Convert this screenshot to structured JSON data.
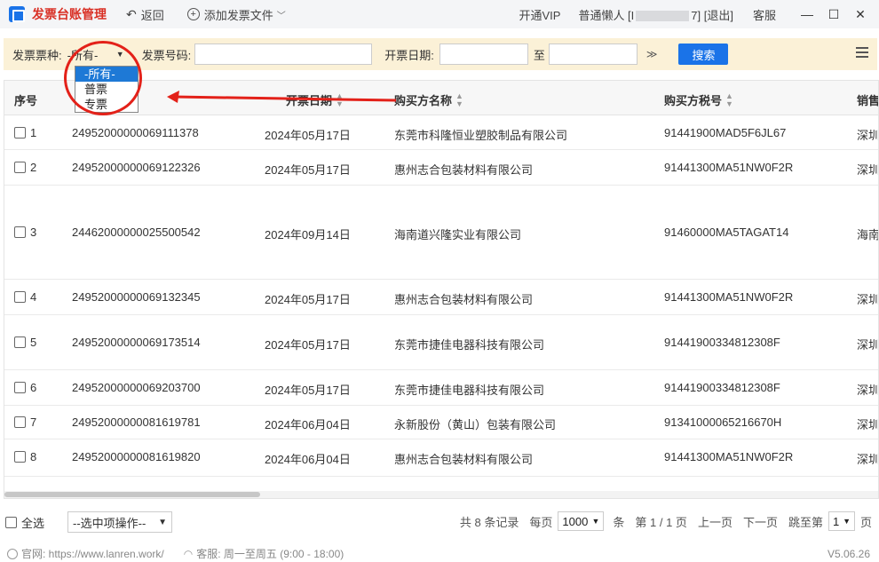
{
  "titlebar": {
    "app_title": "发票台账管理",
    "back_label": "返回",
    "add_label": "添加发票文件",
    "vip_label": "开通VIP",
    "user_prefix": "普通懒人 [I",
    "user_suffix": "7]",
    "logout_label": "[退出]",
    "service_label": "客服"
  },
  "filters": {
    "type_label": "发票票种:",
    "type_value": "-所有-",
    "type_options": [
      "-所有-",
      "普票",
      "专票"
    ],
    "number_label": "发票号码:",
    "number_value": "",
    "date_label": "开票日期:",
    "date_from": "",
    "date_to_label": "至",
    "date_to": "",
    "search_label": "搜索"
  },
  "table": {
    "columns": [
      "序号",
      "开票日期",
      "购买方名称",
      "购买方税号",
      "销售方"
    ],
    "rows": [
      {
        "idx": "1",
        "number": "24952000000069111378",
        "date": "2024年05月17日",
        "buyer": "东莞市科隆恒业塑胶制品有限公司",
        "tax": "91441900MAD5F6JL67",
        "seller": "深圳"
      },
      {
        "idx": "2",
        "number": "24952000000069122326",
        "date": "2024年05月17日",
        "buyer": "惠州志合包装材料有限公司",
        "tax": "91441300MA51NW0F2R",
        "seller": "深圳"
      },
      {
        "idx": "3",
        "number": "24462000000025500542",
        "date": "2024年09月14日",
        "buyer": "海南道兴隆实业有限公司",
        "tax": "91460000MA5TAGAT14",
        "seller": "海南"
      },
      {
        "idx": "4",
        "number": "24952000000069132345",
        "date": "2024年05月17日",
        "buyer": "惠州志合包装材料有限公司",
        "tax": "91441300MA51NW0F2R",
        "seller": "深圳"
      },
      {
        "idx": "5",
        "number": "24952000000069173514",
        "date": "2024年05月17日",
        "buyer": "东莞市捷佳电器科技有限公司",
        "tax": "91441900334812308F",
        "seller": "深圳"
      },
      {
        "idx": "6",
        "number": "24952000000069203700",
        "date": "2024年05月17日",
        "buyer": "东莞市捷佳电器科技有限公司",
        "tax": "91441900334812308F",
        "seller": "深圳"
      },
      {
        "idx": "7",
        "number": "24952000000081619781",
        "date": "2024年06月04日",
        "buyer": "永新股份（黄山）包装有限公司",
        "tax": "91341000065216670H",
        "seller": "深圳"
      },
      {
        "idx": "8",
        "number": "24952000000081619820",
        "date": "2024年06月04日",
        "buyer": "惠州志合包装材料有限公司",
        "tax": "91441300MA51NW0F2R",
        "seller": "深圳"
      }
    ]
  },
  "footer": {
    "select_all": "全选",
    "batch_action": "--选中项操作--",
    "total": "共 8 条记录",
    "per_page_label": "每页",
    "per_page_value": "1000",
    "per_page_unit": "条",
    "page_info": "第 1 / 1 页",
    "prev_label": "上一页",
    "next_label": "下一页",
    "jump_label": "跳至第",
    "jump_value": "1",
    "jump_unit": "页"
  },
  "statusbar": {
    "site": "官网: https://www.lanren.work/",
    "service_hours": "客服: 周一至周五 (9:00 - 18:00)",
    "version": "V5.06.26"
  },
  "colors": {
    "brand_red": "#d93025",
    "accent_blue": "#1a73e8",
    "filter_bg": "#fbf1d7",
    "annotation_red": "#e32119"
  }
}
